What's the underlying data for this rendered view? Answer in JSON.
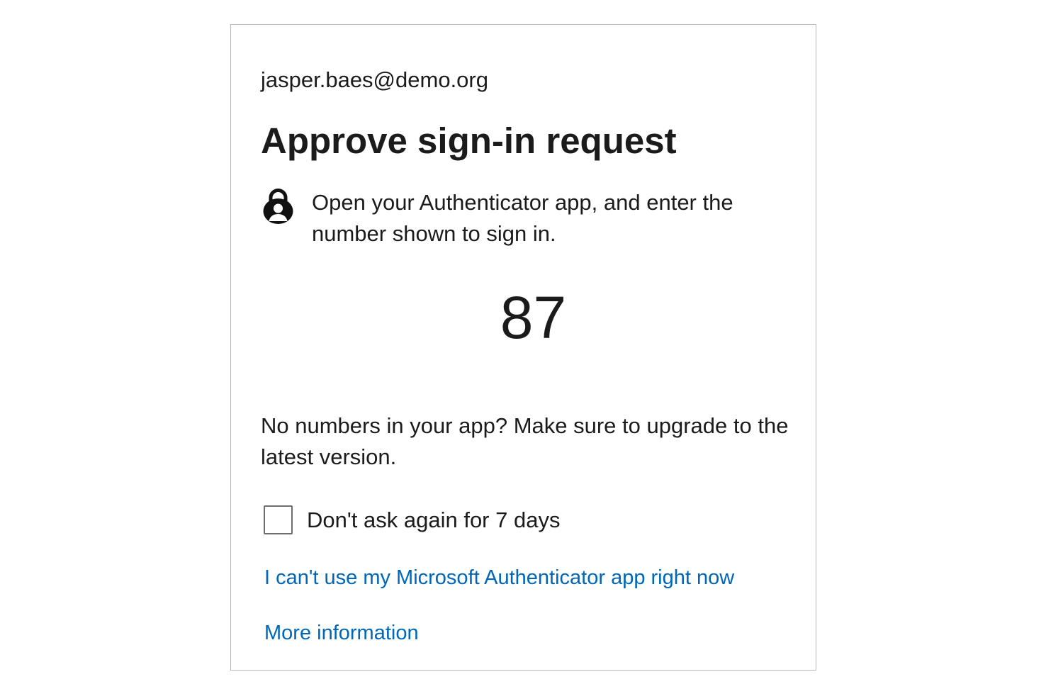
{
  "identity": {
    "email": "jasper.baes@demo.org"
  },
  "heading": {
    "title": "Approve sign-in request"
  },
  "instruction": {
    "icon": "authenticator-lock-icon",
    "text": "Open your Authenticator app, and enter the number shown to sign in."
  },
  "match_number": "87",
  "upgrade_note": "No numbers in your app? Make sure to upgrade to the latest version.",
  "remember": {
    "label": "Don't ask again for 7 days",
    "checked": false
  },
  "links": {
    "cant_use_app": "I can't use my Microsoft Authenticator app right now",
    "more_information": "More information"
  },
  "colors": {
    "link": "#0067b8",
    "text": "#1b1b1b",
    "border": "#b8b8b8"
  }
}
